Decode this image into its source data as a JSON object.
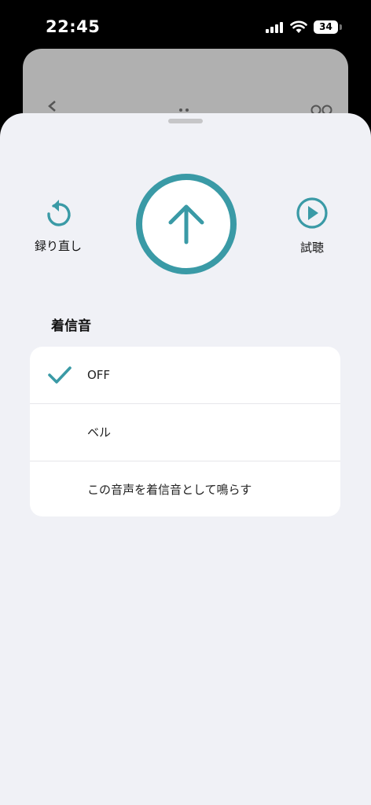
{
  "status_bar": {
    "time": "22:45",
    "battery": "34"
  },
  "actions": {
    "retake_label": "録り直し",
    "retake_icon": "rotate-ccw-icon",
    "preview_label": "試聴",
    "preview_icon": "play-circle-icon",
    "upload_icon": "arrow-up-icon"
  },
  "ringtone": {
    "section_title": "着信音",
    "options": [
      {
        "label": "OFF",
        "selected": true
      },
      {
        "label": "ベル",
        "selected": false
      },
      {
        "label": "この音声を着信音として鳴らす",
        "selected": false
      }
    ]
  },
  "colors": {
    "accent": "#3a9aa6",
    "sheet_background": "#f0f1f6",
    "card_background": "#ffffff"
  }
}
